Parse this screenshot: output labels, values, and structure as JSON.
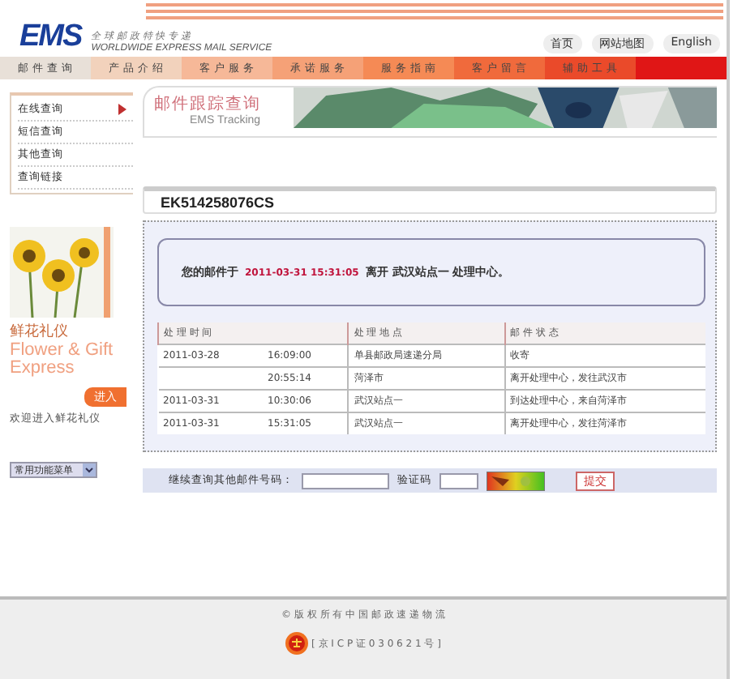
{
  "header": {
    "logo": "EMS",
    "slogan_cn": "全 球 邮 政 特 快 专 递",
    "slogan_en": "WORLDWIDE EXPRESS MAIL SERVICE",
    "links": [
      "首页",
      "网站地图",
      "English"
    ]
  },
  "nav": [
    {
      "label": "邮 件 查 询",
      "color": "#e8e0d8"
    },
    {
      "label": "产 品 介 绍",
      "color": "#f2d2bc"
    },
    {
      "label": "客 户 服 务",
      "color": "#f6b898"
    },
    {
      "label": "承 诺 服 务",
      "color": "#f5a177"
    },
    {
      "label": "服 务 指 南",
      "color": "#f58a55"
    },
    {
      "label": "客 户 留 言",
      "color": "#f06a3c"
    },
    {
      "label": "辅 助 工 具",
      "color": "#ea4a2a"
    },
    {
      "color": "#e01616"
    }
  ],
  "sidebar": {
    "items": [
      {
        "label": "在线查询",
        "selected": true
      },
      {
        "label": "短信查询",
        "selected": false
      },
      {
        "label": "其他查询",
        "selected": false
      },
      {
        "label": "查询链接",
        "selected": false
      }
    ],
    "promo": {
      "title": "鲜花礼仪",
      "subtitle": "Flower & Gift Express",
      "button": "进入",
      "caption": "欢迎进入鲜花礼仪"
    },
    "menu_select": "常用功能菜单"
  },
  "banner": {
    "title": "邮件跟踪查询",
    "subtitle": "EMS Tracking"
  },
  "tracking_number": "EK514258076CS",
  "message": {
    "prefix": "您的邮件于",
    "time": "2011-03-31 15:31:05",
    "suffix": "离开  武汉站点一  处理中心。"
  },
  "table": {
    "columns": [
      "处 理 时 间",
      "处 理 地 点",
      "邮 件 状 态"
    ],
    "rows": [
      {
        "date": "2011-03-28",
        "time": "16:09:00",
        "place": "单县邮政局速递分局",
        "status": "收寄"
      },
      {
        "time": "20:55:14",
        "place": "菏泽市",
        "status": "离开处理中心，发往武汉市"
      },
      {
        "date": "2011-03-31",
        "time": "10:30:06",
        "place": "武汉站点一",
        "status": "到达处理中心，来自菏泽市"
      },
      {
        "date": "2011-03-31",
        "time": "15:31:05",
        "place": "武汉站点一",
        "status": "离开处理中心，发往菏泽市"
      }
    ]
  },
  "query": {
    "label": "继续查询其他邮件号码：",
    "captcha_label": "验证码",
    "submit": "提交"
  },
  "footer": {
    "copyright": "© 版 权 所 有 中 国 邮 政 速 递 物 流",
    "icp": "[ 京 I C P 证 0 3 0 6 2 1 号 ]"
  }
}
